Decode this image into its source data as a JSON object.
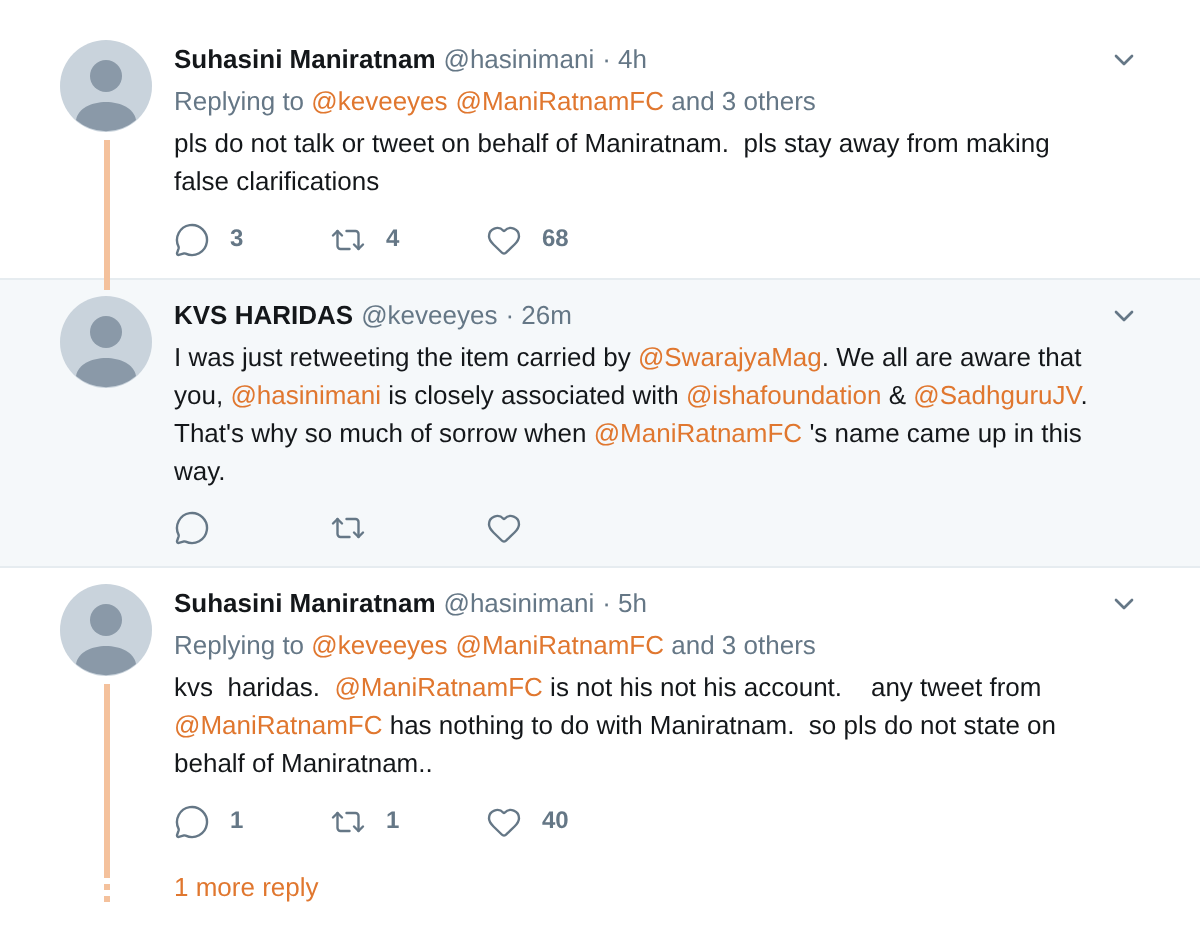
{
  "tweets": [
    {
      "name": "Suhasini Maniratnam",
      "handle": "@hasinimani",
      "time": "· 4h",
      "highlighted": false,
      "thread_line": true,
      "replying_to": [
        {
          "text": "Replying to ",
          "kind": "plain"
        },
        {
          "text": "@keveeyes",
          "kind": "mention"
        },
        {
          "text": "@ManiRatnamFC",
          "kind": "mention"
        },
        {
          "text": " and 3 others",
          "kind": "plain"
        }
      ],
      "body": [
        {
          "text": "pls do not talk or tweet on behalf of Maniratnam.  pls stay away from making false clarifications",
          "kind": "plain"
        }
      ],
      "actions": [
        {
          "kind": "reply",
          "count": "3"
        },
        {
          "kind": "retweet",
          "count": "4"
        },
        {
          "kind": "like",
          "count": "68"
        }
      ]
    },
    {
      "name": "KVS HARIDAS",
      "handle": "@keveeyes",
      "time": "· 26m",
      "highlighted": true,
      "thread_line": false,
      "body": [
        {
          "text": "I was just retweeting the item carried by ",
          "kind": "plain"
        },
        {
          "text": "@SwarajyaMag",
          "kind": "mention"
        },
        {
          "text": ". We all are aware that you, ",
          "kind": "plain"
        },
        {
          "text": "@hasinimani",
          "kind": "mention"
        },
        {
          "text": " is closely associated with ",
          "kind": "plain"
        },
        {
          "text": "@ishafoundation",
          "kind": "mention"
        },
        {
          "text": " & ",
          "kind": "plain"
        },
        {
          "text": "@SadhguruJV",
          "kind": "mention"
        },
        {
          "text": ". That's why so much of sorrow when ",
          "kind": "plain"
        },
        {
          "text": "@ManiRatnamFC",
          "kind": "mention"
        },
        {
          "text": " 's name came up in this way.",
          "kind": "plain"
        }
      ],
      "actions": [
        {
          "kind": "reply"
        },
        {
          "kind": "retweet"
        },
        {
          "kind": "like"
        }
      ]
    },
    {
      "name": "Suhasini Maniratnam",
      "handle": "@hasinimani",
      "time": "· 5h",
      "highlighted": false,
      "thread_line": true,
      "replying_to": [
        {
          "text": "Replying to ",
          "kind": "plain"
        },
        {
          "text": "@keveeyes",
          "kind": "mention"
        },
        {
          "text": "@ManiRatnamFC",
          "kind": "mention"
        },
        {
          "text": " and 3 others",
          "kind": "plain"
        }
      ],
      "body": [
        {
          "text": "kvs  haridas.  ",
          "kind": "plain"
        },
        {
          "text": "@ManiRatnamFC",
          "kind": "mention"
        },
        {
          "text": " is not his not his account.    any tweet from ",
          "kind": "plain"
        },
        {
          "text": "@ManiRatnamFC",
          "kind": "mention"
        },
        {
          "text": " has nothing to do with Maniratnam.  so pls do not state on behalf of Maniratnam..",
          "kind": "plain"
        }
      ],
      "actions": [
        {
          "kind": "reply",
          "count": "1"
        },
        {
          "kind": "retweet",
          "count": "1"
        },
        {
          "kind": "like",
          "count": "40"
        }
      ]
    }
  ],
  "more_replies": "1 more reply"
}
